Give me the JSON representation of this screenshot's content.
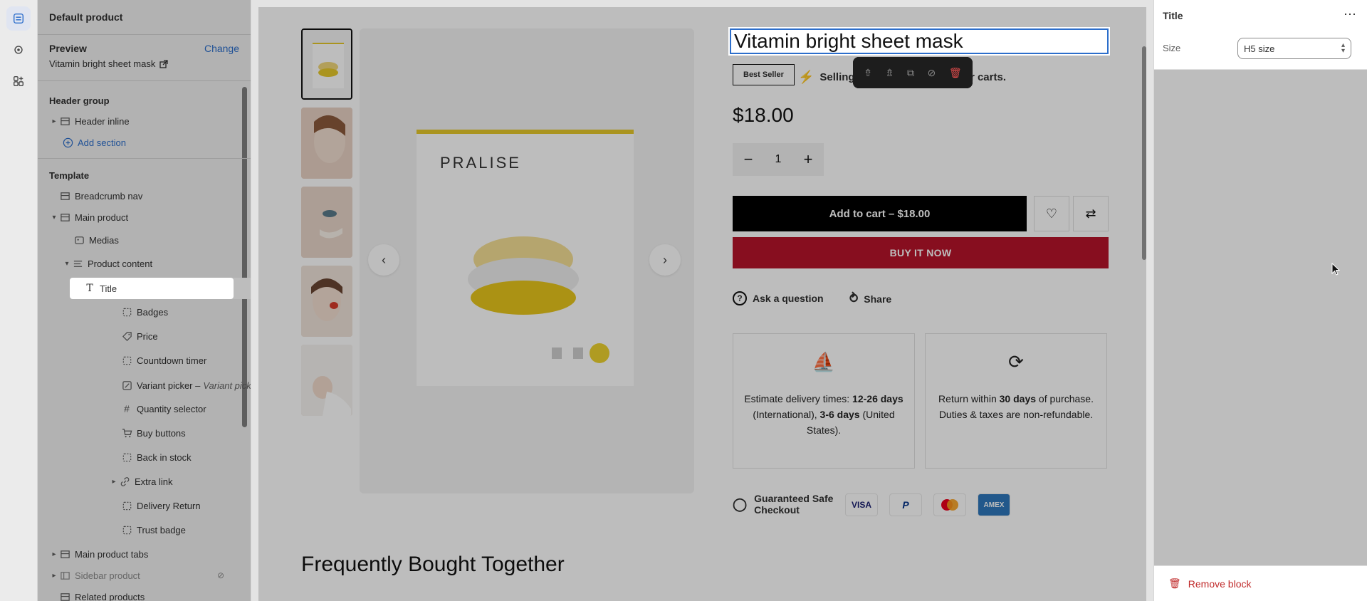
{
  "rail": {
    "icons": [
      "sections-icon",
      "gear-icon",
      "apps-icon"
    ]
  },
  "sidebar": {
    "store_name": "Default product",
    "preview_heading": "Preview",
    "change_label": "Change",
    "preview_value": "Vitamin bright sheet mask",
    "header_group": {
      "title": "Header group",
      "items": [
        {
          "label": "Header inline"
        }
      ],
      "add_section": "Add section"
    },
    "template": {
      "title": "Template",
      "items": [
        {
          "label": "Breadcrumb nav"
        },
        {
          "label": "Main product"
        },
        {
          "label": "Medias"
        },
        {
          "label": "Product content"
        },
        {
          "label": "Title"
        },
        {
          "label": "Badges"
        },
        {
          "label": "Price"
        },
        {
          "label": "Countdown timer"
        },
        {
          "label": "Variant picker –",
          "sub": "Variant picker"
        },
        {
          "label": "Quantity selector"
        },
        {
          "label": "Buy buttons"
        },
        {
          "label": "Back in stock"
        },
        {
          "label": "Extra link"
        },
        {
          "label": "Delivery Return"
        },
        {
          "label": "Trust badge"
        },
        {
          "label": "Main product tabs"
        },
        {
          "label": "Sidebar product"
        },
        {
          "label": "Related products"
        }
      ]
    }
  },
  "product": {
    "title": "Vitamin bright sheet mask",
    "badge": "Best Seller",
    "selling_text_left": "Selling fas",
    "selling_text_right": "eir carts.",
    "price": "$18.00",
    "quantity": "1",
    "add_to_cart": "Add to cart – $18.00",
    "buy_now": "BUY IT NOW",
    "ask_question": "Ask a question",
    "share": "Share",
    "brand_on_image": "PRALISE",
    "delivery": {
      "pre": "Estimate delivery times: ",
      "b1": "12-26 days",
      "mid": " (International), ",
      "b2": "3-6 days",
      "post": " (United States)."
    },
    "returns": {
      "pre": "Return within ",
      "b1": "30 days",
      "post": " of purchase. Duties & taxes are non-refundable."
    },
    "guaranteed_line1": "Guaranteed Safe",
    "guaranteed_line2": "Checkout",
    "payments": [
      "VISA",
      "PayPal",
      "Mastercard",
      "AMEX"
    ],
    "fbt_heading": "Frequently Bought Together"
  },
  "settings": {
    "title": "Title",
    "size_label": "Size",
    "size_value": "H5 size",
    "remove_block": "Remove block"
  },
  "colors": {
    "accent": "#2c6ecb",
    "buy_now": "#b7142a",
    "danger": "#c02a2a"
  }
}
